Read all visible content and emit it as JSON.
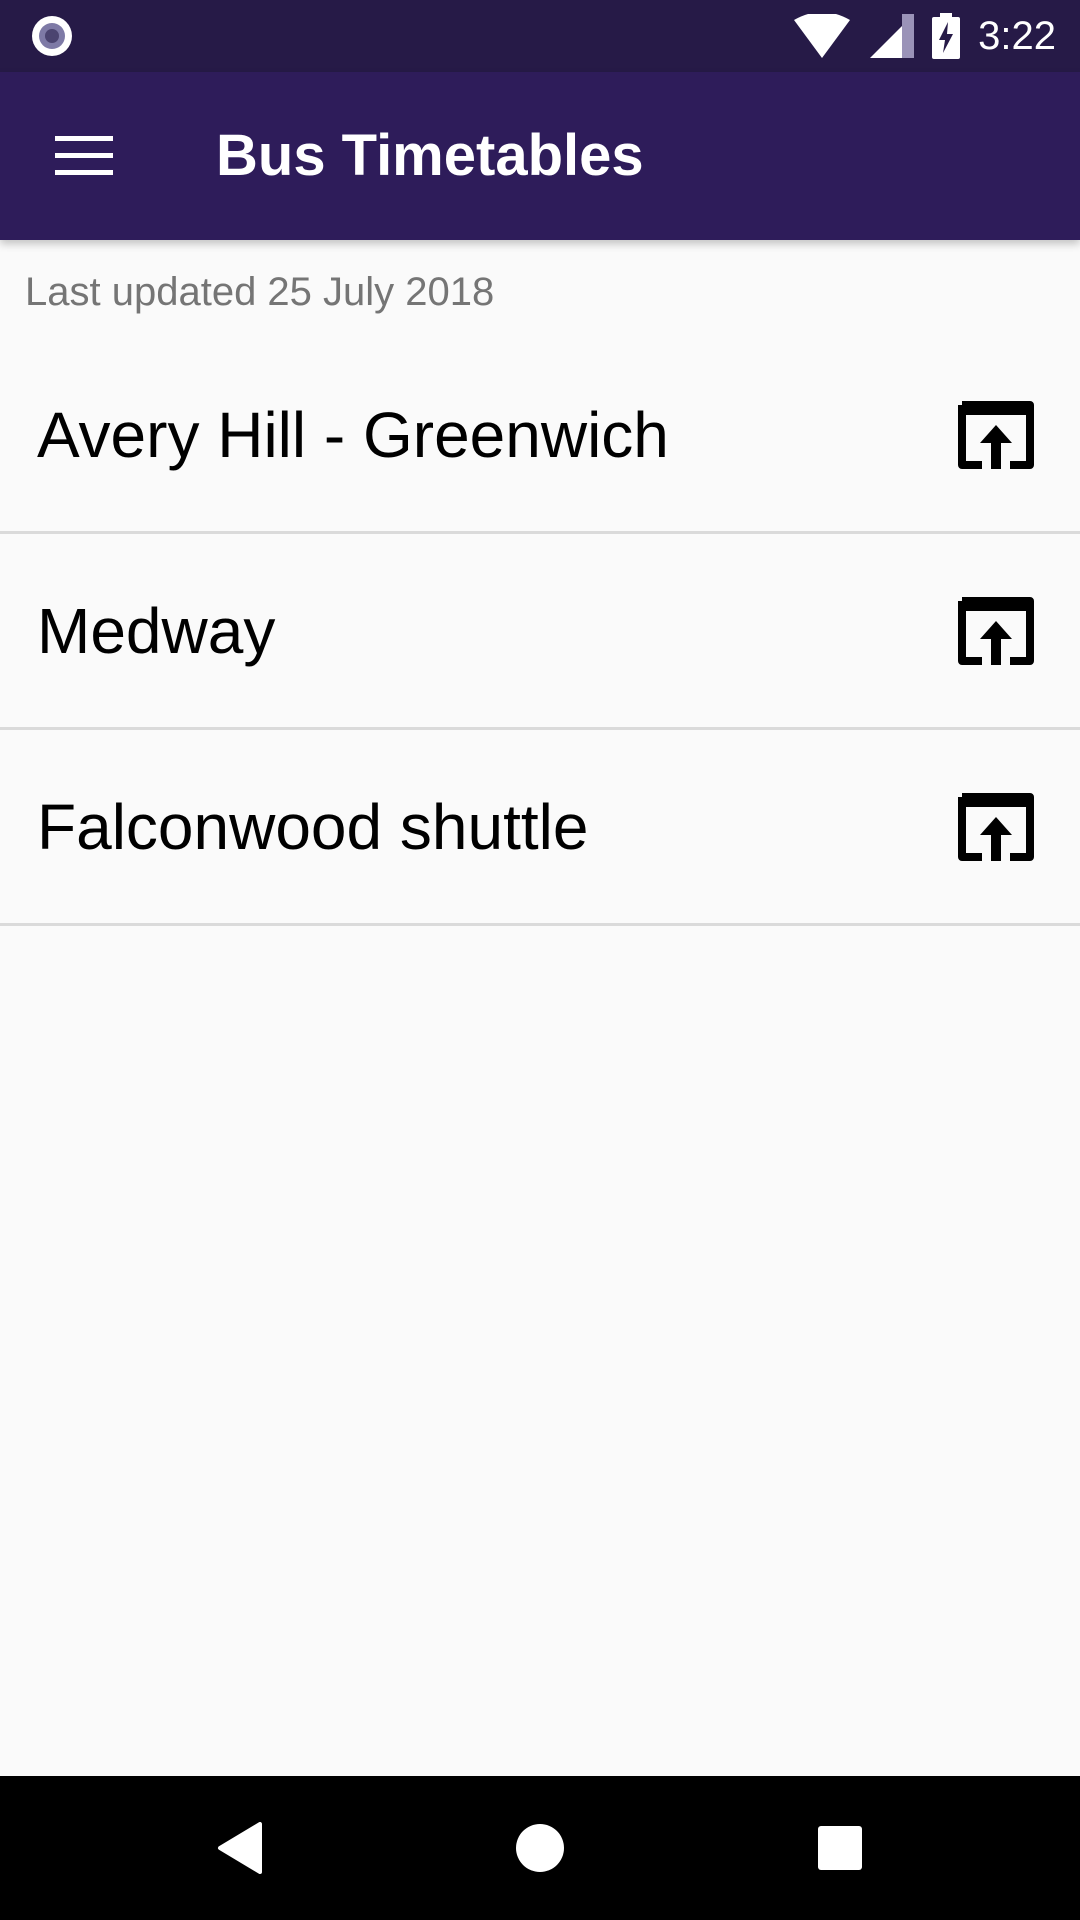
{
  "status_bar": {
    "time": "3:22",
    "icons": [
      "record-indicator-icon",
      "wifi-icon",
      "signal-icon",
      "battery-charging-icon"
    ]
  },
  "app_bar": {
    "title": "Bus Timetables",
    "menu_icon": "hamburger-menu-icon"
  },
  "content": {
    "last_updated": "Last updated 25 July 2018",
    "routes": [
      {
        "label": "Avery Hill - Greenwich",
        "icon": "open-external-icon"
      },
      {
        "label": "Medway",
        "icon": "open-external-icon"
      },
      {
        "label": "Falconwood shuttle",
        "icon": "open-external-icon"
      }
    ]
  },
  "nav_bar": {
    "icons": [
      "back-icon",
      "home-icon",
      "recents-icon"
    ]
  },
  "colors": {
    "status_bar": "#261a47",
    "app_bar": "#2e1c5a",
    "background": "#fafafa",
    "divider": "#dadada",
    "secondary_text": "#757575"
  }
}
